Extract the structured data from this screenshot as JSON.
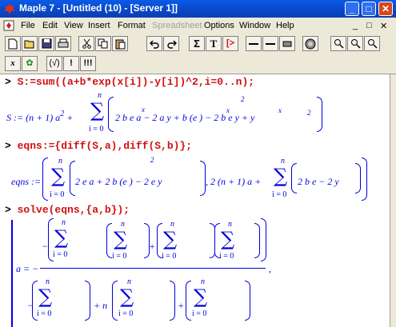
{
  "window": {
    "title": "Maple 7 - [Untitled (10) - [Server 1]]"
  },
  "window_controls": {
    "minimize": "_",
    "maximize": "□",
    "close": "✕"
  },
  "menu": {
    "items": [
      "File",
      "Edit",
      "View",
      "Insert",
      "Format",
      "Spreadsheet",
      "Options",
      "Window",
      "Help"
    ],
    "disabled": [
      "Spreadsheet"
    ],
    "mdi_controls": [
      "_",
      "□",
      "✕"
    ]
  },
  "toolbar1": [
    "new",
    "open",
    "save",
    "print",
    "cut",
    "copy",
    "paste",
    "undo",
    "redo",
    "Σ",
    "T",
    "[>",
    "⇤",
    "⇥",
    "stop",
    "zoom-in",
    "zoom-out",
    "zoom-out2"
  ],
  "toolbar1_labels": {
    "sigma": "Σ",
    "text": "T",
    "prompt": "[>"
  },
  "toolbar2": {
    "b1": "x",
    "b2": "✿",
    "b3": "(√)",
    "b4": "!",
    "b5": "!!!"
  },
  "document": {
    "prompt_symbol": ">",
    "inputs": [
      "S:=sum((a+b*exp(x[i])-y[i])^2,i=0..n);",
      "eqns:={diff(S,a),diff(S,b)};",
      "solve(eqns,{a,b});"
    ],
    "out1": {
      "lhs": "S := (n + 1) a",
      "rest": "+",
      "upper": "n",
      "lower": "i = 0",
      "body": "2 b e a − 2 a y + b (e ) − 2 b e y + y",
      "exp2": "2",
      "exp": "x",
      "sub": "i",
      "suffix": ")"
    },
    "out2": {
      "lhs": "eqns :=",
      "upper": "n",
      "lower": "i = 0",
      "body1": "2 e a + 2 b (e ) − 2 e y",
      "mid": ", 2 (n + 1) a +",
      "body2": "2 b e − 2 y",
      "exp2": "2"
    },
    "out3": {
      "lhs": "a = −",
      "upper": "n",
      "lower": "i = 0",
      "plus": "+",
      "minus": "−",
      "nfactor": "n",
      "trail": ","
    }
  },
  "colors": {
    "title_bar": "#0a46c8",
    "input": "#d01010",
    "output": "#0000e0",
    "chrome": "#ece9d8"
  }
}
